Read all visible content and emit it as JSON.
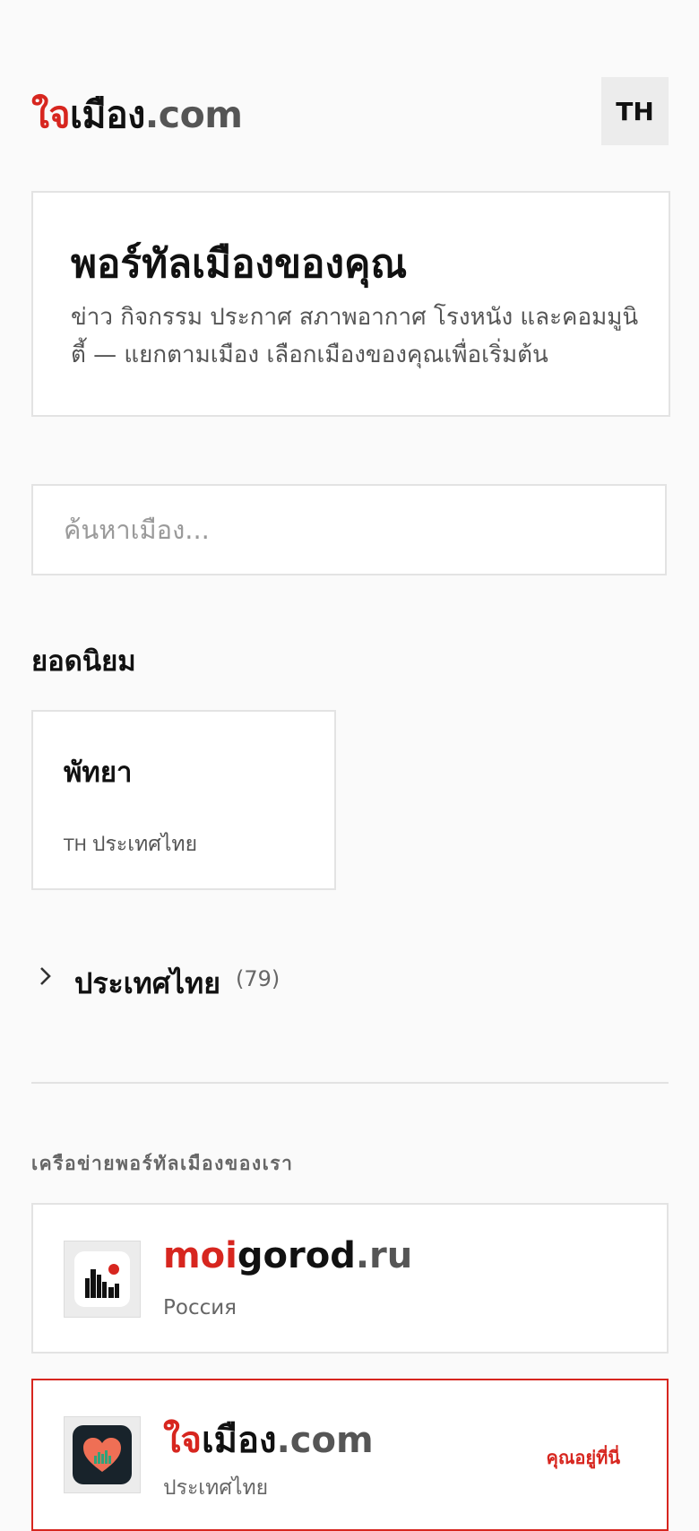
{
  "header": {
    "logo": {
      "part1": "ใจ",
      "part2": "เมือง",
      "part3": ".com"
    },
    "language_button": "TH"
  },
  "hero": {
    "title": "พอร์ทัลเมืองของคุณ",
    "subtitle": "ข่าว กิจกรรม ประกาศ สภาพอากาศ โรงหนัง และคอมมูนิตี้ — แยกตามเมือง เลือกเมืองของคุณเพื่อเริ่มต้น"
  },
  "search": {
    "placeholder": "ค้นหาเมือง..."
  },
  "popular": {
    "title": "ยอดนิยม",
    "cities": [
      {
        "name": "พัทยา",
        "country_code": "TH",
        "country": "ประเทศไทย"
      }
    ]
  },
  "countries": [
    {
      "name": "ประเทศไทย",
      "count": "(79)",
      "icon": "chevron-right-icon"
    }
  ],
  "network": {
    "title": "เครือข่ายพอร์ทัลเมืองของเรา",
    "portals": [
      {
        "name_part1": "moi",
        "name_part2": "gorod",
        "name_part3": ".ru",
        "country": "Россия",
        "icon": "city-buildings-icon"
      },
      {
        "name_part1": "ใจ",
        "name_part2": "เมือง",
        "name_part3": ".com",
        "country": "ประเทศไทย",
        "current_label": "คุณอยู่ที่นี่",
        "icon": "heart-city-icon"
      }
    ]
  },
  "colors": {
    "accent": "#d7261f",
    "background": "#fafafa",
    "border": "#e3e3e3"
  }
}
